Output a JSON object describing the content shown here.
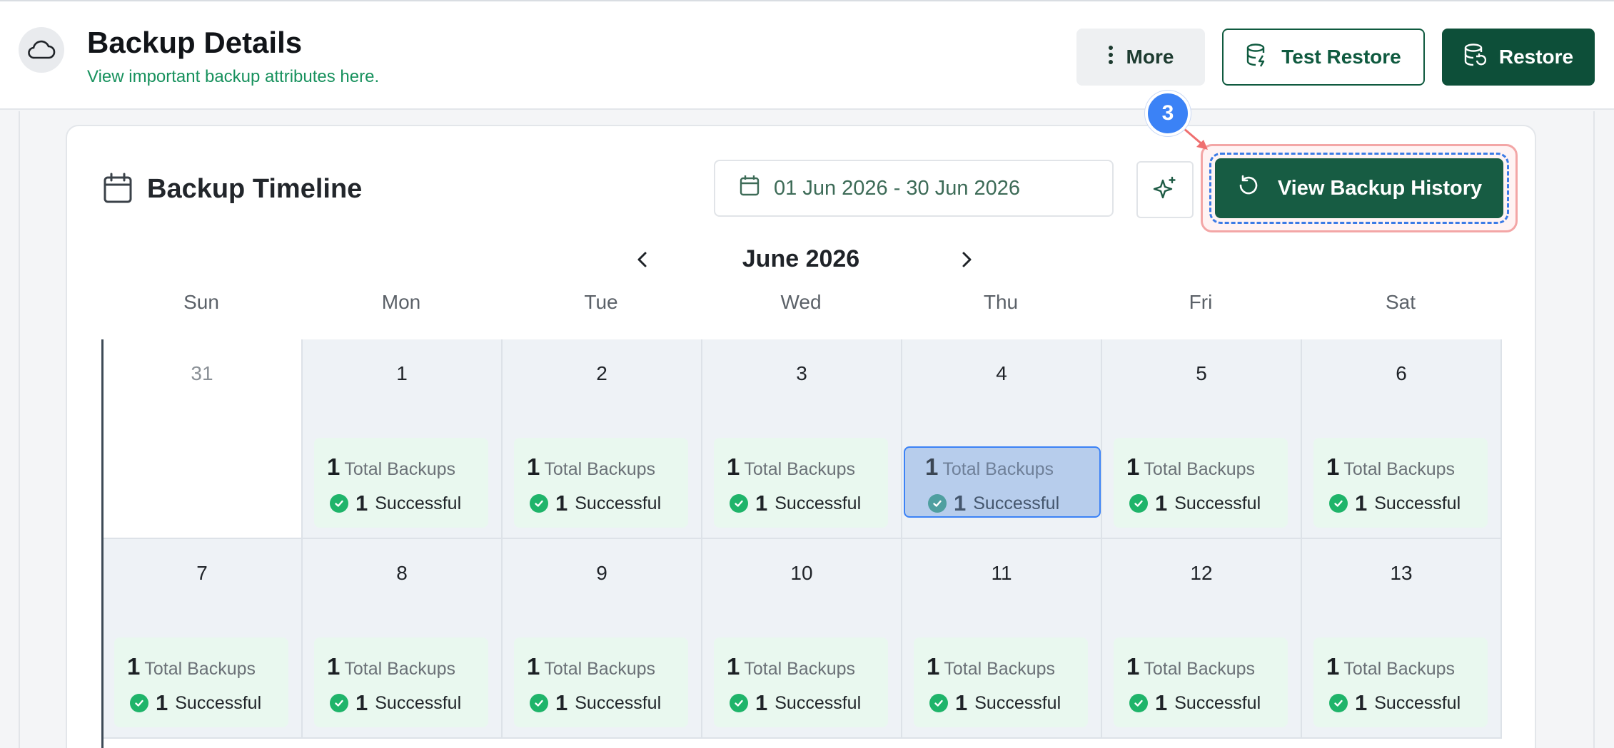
{
  "header": {
    "title": "Backup Details",
    "subtitle": "View important backup attributes here.",
    "more_label": "More",
    "test_restore_label": "Test Restore",
    "restore_label": "Restore"
  },
  "timeline": {
    "title": "Backup Timeline",
    "date_range": "01 Jun 2026 - 30 Jun 2026",
    "view_history_label": "View Backup History",
    "month": "June 2026",
    "weekdays": [
      "Sun",
      "Mon",
      "Tue",
      "Wed",
      "Thu",
      "Fri",
      "Sat"
    ],
    "total_label": "Total Backups",
    "success_label": "Successful",
    "weeks": [
      [
        {
          "date": "31",
          "prev_month": true
        },
        {
          "date": "1",
          "total": "1",
          "successful": "1"
        },
        {
          "date": "2",
          "total": "1",
          "successful": "1"
        },
        {
          "date": "3",
          "total": "1",
          "successful": "1"
        },
        {
          "date": "4",
          "total": "1",
          "successful": "1",
          "selected": true
        },
        {
          "date": "5",
          "total": "1",
          "successful": "1"
        },
        {
          "date": "6",
          "total": "1",
          "successful": "1"
        }
      ],
      [
        {
          "date": "7",
          "total": "1",
          "successful": "1"
        },
        {
          "date": "8",
          "total": "1",
          "successful": "1"
        },
        {
          "date": "9",
          "total": "1",
          "successful": "1"
        },
        {
          "date": "10",
          "total": "1",
          "successful": "1"
        },
        {
          "date": "11",
          "total": "1",
          "successful": "1"
        },
        {
          "date": "12",
          "total": "1",
          "successful": "1"
        },
        {
          "date": "13",
          "total": "1",
          "successful": "1"
        }
      ]
    ]
  },
  "annotations": {
    "badge_big": "3",
    "badge_small": "3"
  },
  "colors": {
    "primary": "#0d4f39",
    "accent_green": "#17915d",
    "success": "#1fb46a",
    "annotation_blue": "#3b82f6"
  }
}
